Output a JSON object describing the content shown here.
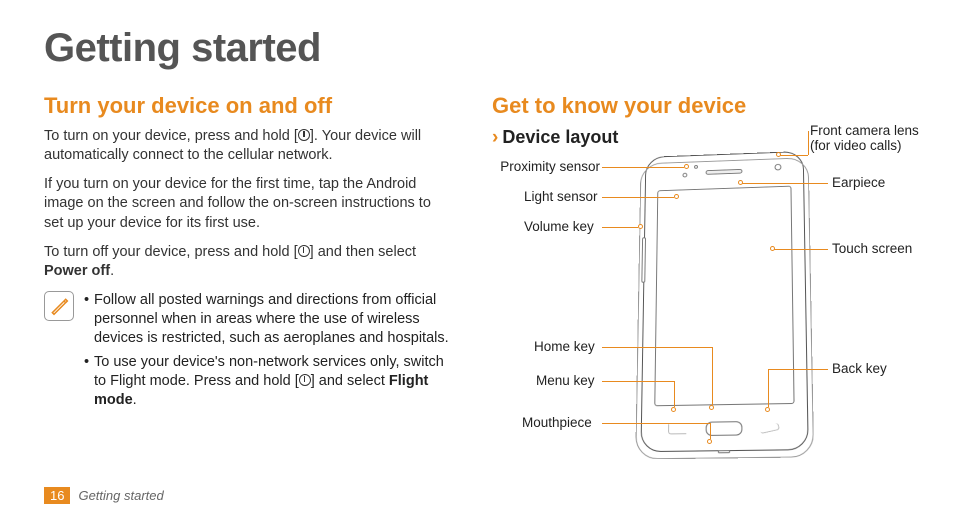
{
  "page": {
    "title": "Getting started",
    "number": "16",
    "footer_section": "Getting started"
  },
  "left": {
    "heading": "Turn your device on and off",
    "p1a": "To turn on your device, press and hold [",
    "p1b": "]. Your device will automatically connect to the cellular network.",
    "p2": "If you turn on your device for the first time, tap the Android image on the screen and follow the on-screen instructions to set up your device for its first use.",
    "p3a": "To turn off your device, press and hold [",
    "p3b": "] and then select ",
    "p3c": "Power off",
    "p3d": ".",
    "note1": "Follow all posted warnings and directions from official personnel when in areas where the use of wireless devices is restricted, such as aeroplanes and hospitals.",
    "note2a": "To use your device's non-network services only, switch to Flight mode. Press and hold [",
    "note2b": "] and select ",
    "note2c": "Flight mode",
    "note2d": "."
  },
  "right": {
    "heading": "Get to know your device",
    "sub": "Device layout",
    "labels": {
      "proximity": "Proximity sensor",
      "light": "Light sensor",
      "volume": "Volume key",
      "home": "Home key",
      "menu": "Menu key",
      "mouth": "Mouthpiece",
      "cam": "Front camera lens",
      "cam2": "(for video calls)",
      "ear": "Earpiece",
      "touch": "Touch screen",
      "back": "Back key"
    }
  }
}
